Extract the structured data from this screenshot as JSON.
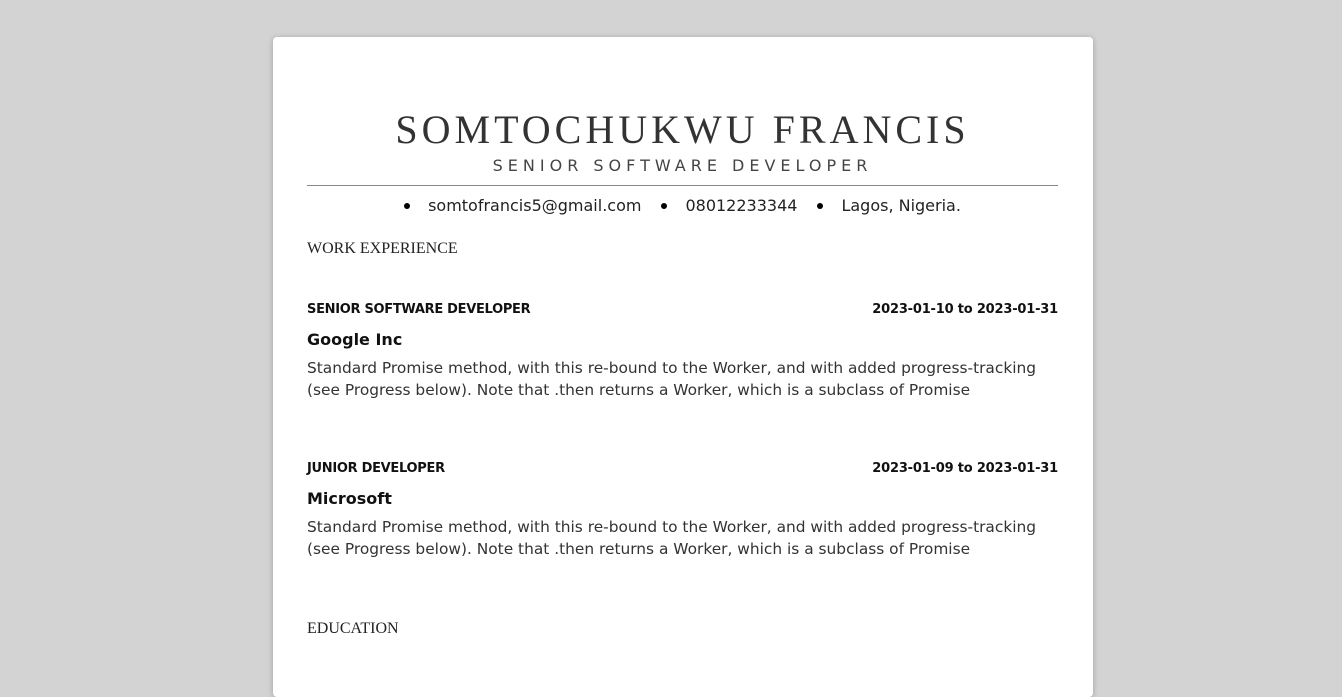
{
  "resume": {
    "name": "SOMTOCHUKWU FRANCIS",
    "role": "SENIOR SOFTWARE DEVELOPER",
    "contacts": {
      "email": "somtofrancis5@gmail.com",
      "phone": "08012233344",
      "location": "Lagos, Nigeria."
    },
    "sections": {
      "work": {
        "title": "WORK EXPERIENCE",
        "jobs": [
          {
            "title": "SENIOR SOFTWARE DEVELOPER",
            "dates": "2023-01-10 to 2023-01-31",
            "company": "Google Inc",
            "description": "Standard Promise method, with this re-bound to the Worker, and with added progress-tracking (see Progress below). Note that .then returns a Worker, which is a subclass of Promise"
          },
          {
            "title": "JUNIOR DEVELOPER",
            "dates": "2023-01-09 to 2023-01-31",
            "company": "Microsoft",
            "description": "Standard Promise method, with this re-bound to the Worker, and with added progress-tracking (see Progress below). Note that .then returns a Worker, which is a subclass of Promise"
          }
        ]
      },
      "education": {
        "title": "EDUCATION"
      }
    }
  },
  "colors": {
    "background": "#d3d3d3",
    "page": "#ffffff",
    "text": "#333333"
  }
}
